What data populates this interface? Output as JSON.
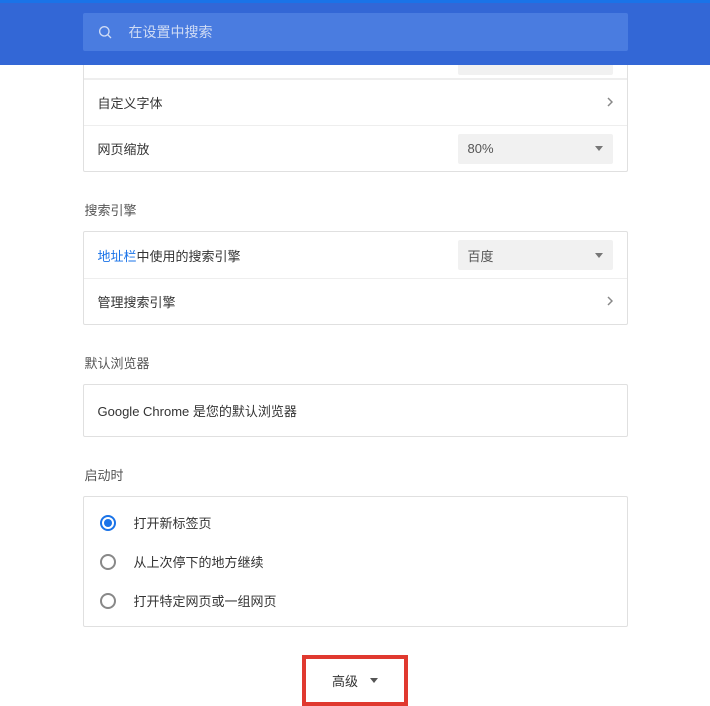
{
  "search": {
    "placeholder": "在设置中搜索"
  },
  "appearance": {
    "font_peek_label": "",
    "font_peek_value": "",
    "custom_fonts": "自定义字体",
    "page_zoom_label": "网页缩放",
    "page_zoom_value": "80%"
  },
  "search_engine": {
    "section_title": "搜索引擎",
    "address_bar_prefix_link": "地址栏",
    "address_bar_suffix": "中使用的搜索引擎",
    "selected_engine": "百度",
    "manage": "管理搜索引擎"
  },
  "default_browser": {
    "section_title": "默认浏览器",
    "info": "Google Chrome 是您的默认浏览器"
  },
  "on_startup": {
    "section_title": "启动时",
    "options": [
      "打开新标签页",
      "从上次停下的地方继续",
      "打开特定网页或一组网页"
    ],
    "selected_index": 0
  },
  "advanced": {
    "label": "高级"
  }
}
